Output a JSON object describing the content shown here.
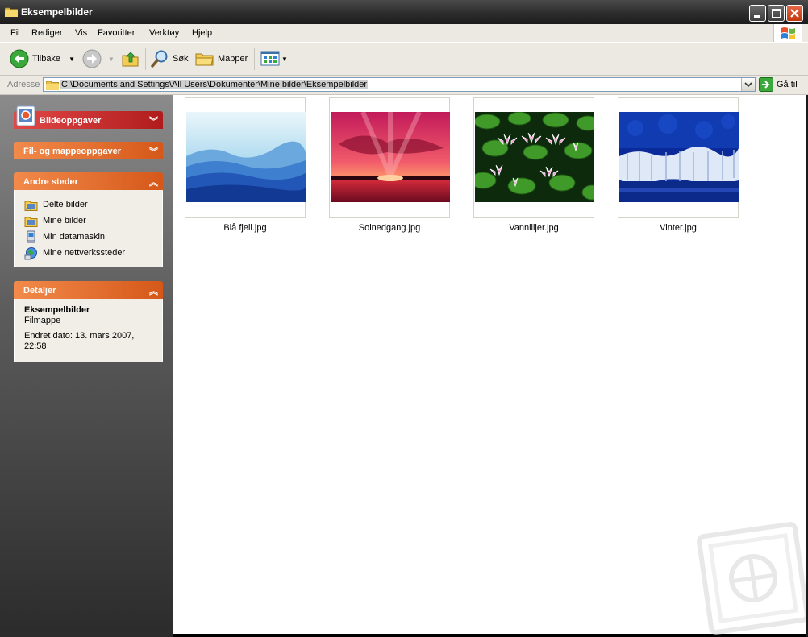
{
  "window": {
    "title": "Eksempelbilder"
  },
  "menu": [
    {
      "name": "menu-fil",
      "label": "Fil"
    },
    {
      "name": "menu-rediger",
      "label": "Rediger"
    },
    {
      "name": "menu-vis",
      "label": "Vis"
    },
    {
      "name": "menu-favoritter",
      "label": "Favoritter"
    },
    {
      "name": "menu-verktoy",
      "label": "Verktøy"
    },
    {
      "name": "menu-hjelp",
      "label": "Hjelp"
    }
  ],
  "toolbar": {
    "back_label": "Tilbake",
    "search_label": "Søk",
    "folders_label": "Mapper"
  },
  "address": {
    "label": "Adresse",
    "path": "C:\\Documents and Settings\\All Users\\Dokumenter\\Mine bilder\\Eksempelbilder",
    "go_label": "Gå til"
  },
  "tasks": {
    "picture_tasks": "Bildeoppgaver",
    "file_tasks": "Fil- og mappeoppgaver",
    "other_places": {
      "title": "Andre steder",
      "items": [
        "Delte bilder",
        "Mine bilder",
        "Min datamaskin",
        "Mine nettverkssteder"
      ]
    },
    "details": {
      "title": "Detaljer",
      "name": "Eksempelbilder",
      "type": "Filmappe",
      "modified_line1": "Endret dato: 13. mars 2007,",
      "modified_line2": "22:58"
    }
  },
  "files": [
    "Blå fjell.jpg",
    "Solnedgang.jpg",
    "Vannliljer.jpg",
    "Vinter.jpg"
  ],
  "icons": {
    "back": "back-arrow-icon",
    "forward": "forward-arrow-icon",
    "up": "folder-up-icon",
    "search": "search-icon",
    "folders": "folders-icon",
    "views": "views-icon",
    "go": "go-arrow-icon"
  }
}
